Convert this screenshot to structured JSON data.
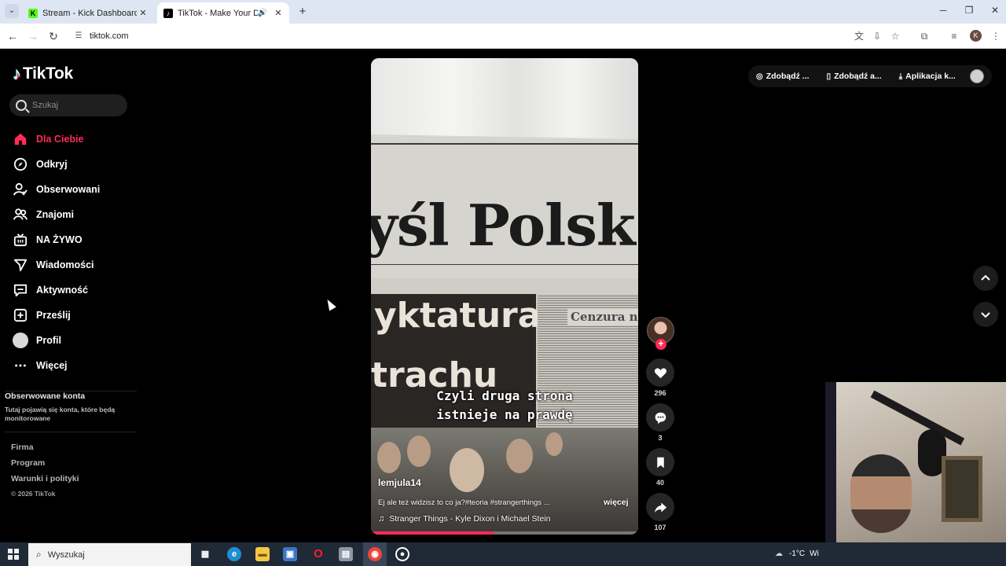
{
  "browser": {
    "tabs": [
      {
        "title": "Stream - Kick Dashboard",
        "favicon": "kick-icon",
        "active": false
      },
      {
        "title": "TikTok - Make Your Day",
        "favicon": "tiktok-icon",
        "active": true
      }
    ],
    "url": "tiktok.com",
    "profile_initial": "K"
  },
  "sidebar": {
    "logo": "TikTok",
    "search_placeholder": "Szukaj",
    "items": [
      {
        "label": "Dla Ciebie",
        "icon": "home-icon",
        "active": true
      },
      {
        "label": "Odkryj",
        "icon": "compass-icon"
      },
      {
        "label": "Obserwowani",
        "icon": "following-icon"
      },
      {
        "label": "Znajomi",
        "icon": "friends-icon"
      },
      {
        "label": "NA ŻYWO",
        "icon": "live-icon"
      },
      {
        "label": "Wiadomości",
        "icon": "messages-icon"
      },
      {
        "label": "Aktywność",
        "icon": "activity-icon"
      },
      {
        "label": "Prześlij",
        "icon": "upload-icon"
      },
      {
        "label": "Profil",
        "icon": "avatar"
      },
      {
        "label": "Więcej",
        "icon": "more-icon"
      }
    ],
    "followed_title": "Obserwowane konta",
    "followed_desc": "Tutaj pojawią się konta, które będą monitorowane",
    "footer": [
      "Firma",
      "Program",
      "Warunki i polityki"
    ],
    "copyright": "© 2026 TikTok"
  },
  "top_actions": [
    {
      "label": "Zdobądź ...",
      "icon": "coin-icon"
    },
    {
      "label": "Zdobądź a...",
      "icon": "phone-icon"
    },
    {
      "label": "Aplikacja k...",
      "icon": "download-icon"
    }
  ],
  "video": {
    "newspaper_title": "yśl Polsk",
    "headline_1": "yktatura",
    "headline_2": "trachu",
    "side_headline": "Cenzura nie p",
    "caption_1": "Czyli druga strona",
    "caption_2": "istnieje na prawdę",
    "author": "lemjula14",
    "description": "Ej ale też widzisz to co ja?#teoria #strangerthings ...",
    "more": "więcej",
    "music": "Stranger Things - Kyle Dixon i Michael Stein",
    "progress_fraction": 0.46
  },
  "actions": {
    "likes": "296",
    "comments": "3",
    "saves": "40",
    "shares": "107"
  },
  "taskbar": {
    "search_placeholder": "Wyszukaj",
    "weather": "-1°C",
    "weather_extra": "Wi"
  },
  "colors": {
    "accent": "#fe2c55",
    "background": "#000000",
    "chrome_tabbar": "#dfe6f3"
  }
}
